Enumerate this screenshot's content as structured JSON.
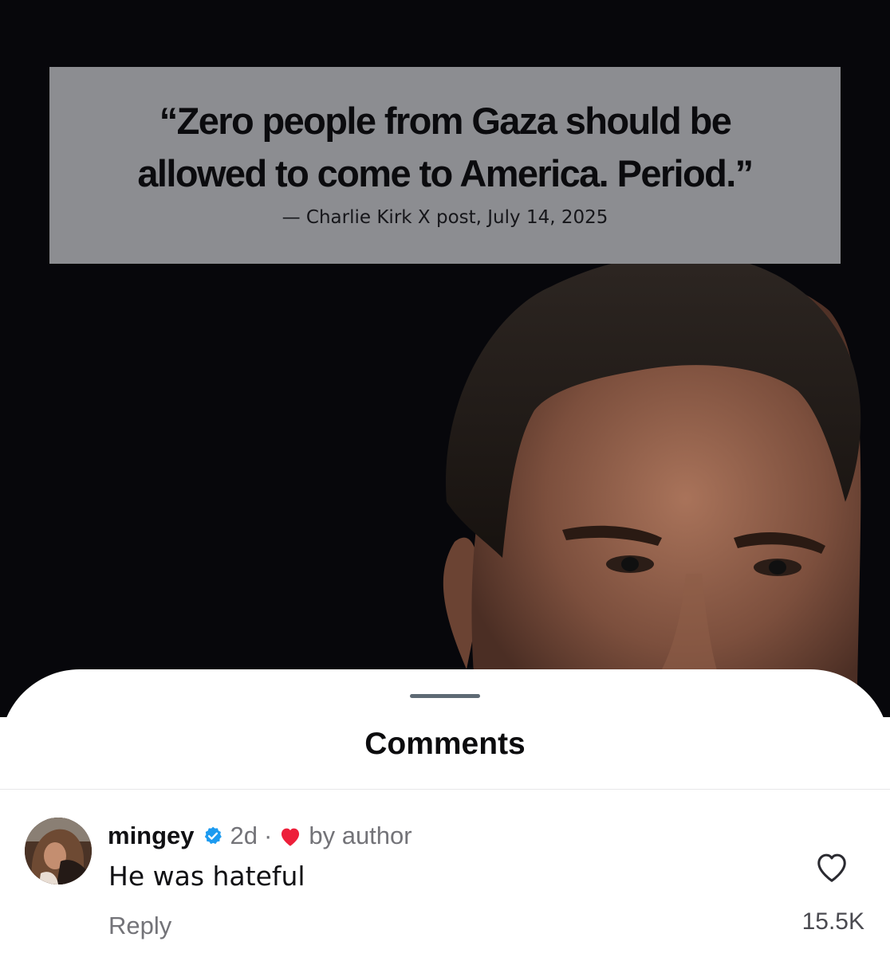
{
  "post": {
    "quote_line_1": "“Zero people from Gaza should be",
    "quote_line_2": "allowed to come to America. Period.”",
    "attribution": "— Charlie Kirk X post, July 14, 2025",
    "background_color": "#07070b",
    "quote_box_color": "#8c8d91"
  },
  "comments_sheet": {
    "title": "Comments",
    "comment": {
      "username": "mingey",
      "verified": true,
      "time_ago": "2d",
      "separator": "·",
      "liked_by_author_label": "by author",
      "text": "He was hateful",
      "reply_label": "Reply",
      "like_count": "15.5K",
      "avatar_icon": "avatar-photo",
      "verified_icon": "verified-badge-icon",
      "author_like_icon": "red-heart-icon",
      "like_icon": "heart-outline-icon"
    }
  },
  "colors": {
    "verified_blue": "#1d9bf0",
    "heart_red": "#ed1f3a",
    "secondary_text": "#737378"
  }
}
